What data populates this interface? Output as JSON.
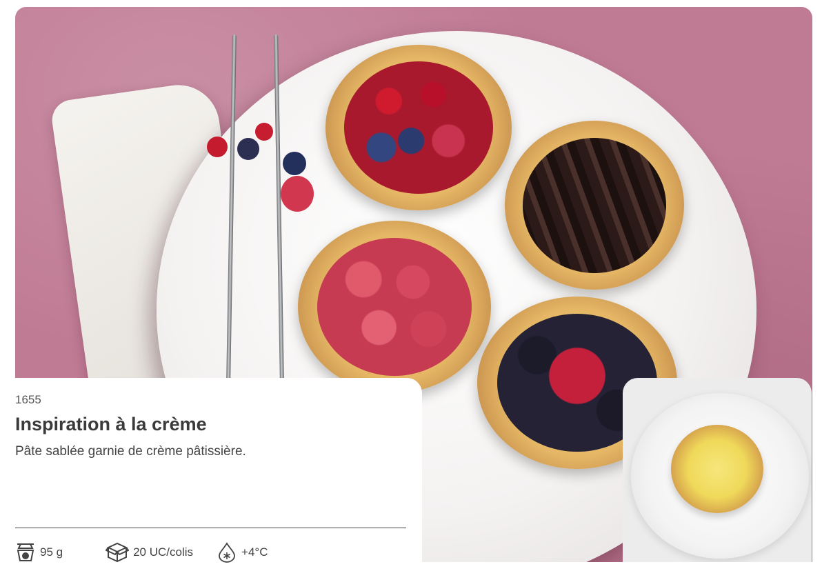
{
  "product": {
    "code": "1655",
    "title": "Inspiration à la crème",
    "description": "Pâte sablée garnie de crème pâtissière."
  },
  "specs": {
    "weight": "95 g",
    "packaging": "20 UC/colis",
    "temperature": "+4°C"
  },
  "icons": {
    "weight": "scale-icon",
    "packaging": "box-icon",
    "temperature": "snowflake-drop-icon"
  },
  "colors": {
    "background_pink": "#c07b94",
    "title_text": "#3a3a3a",
    "body_text": "#444444"
  }
}
